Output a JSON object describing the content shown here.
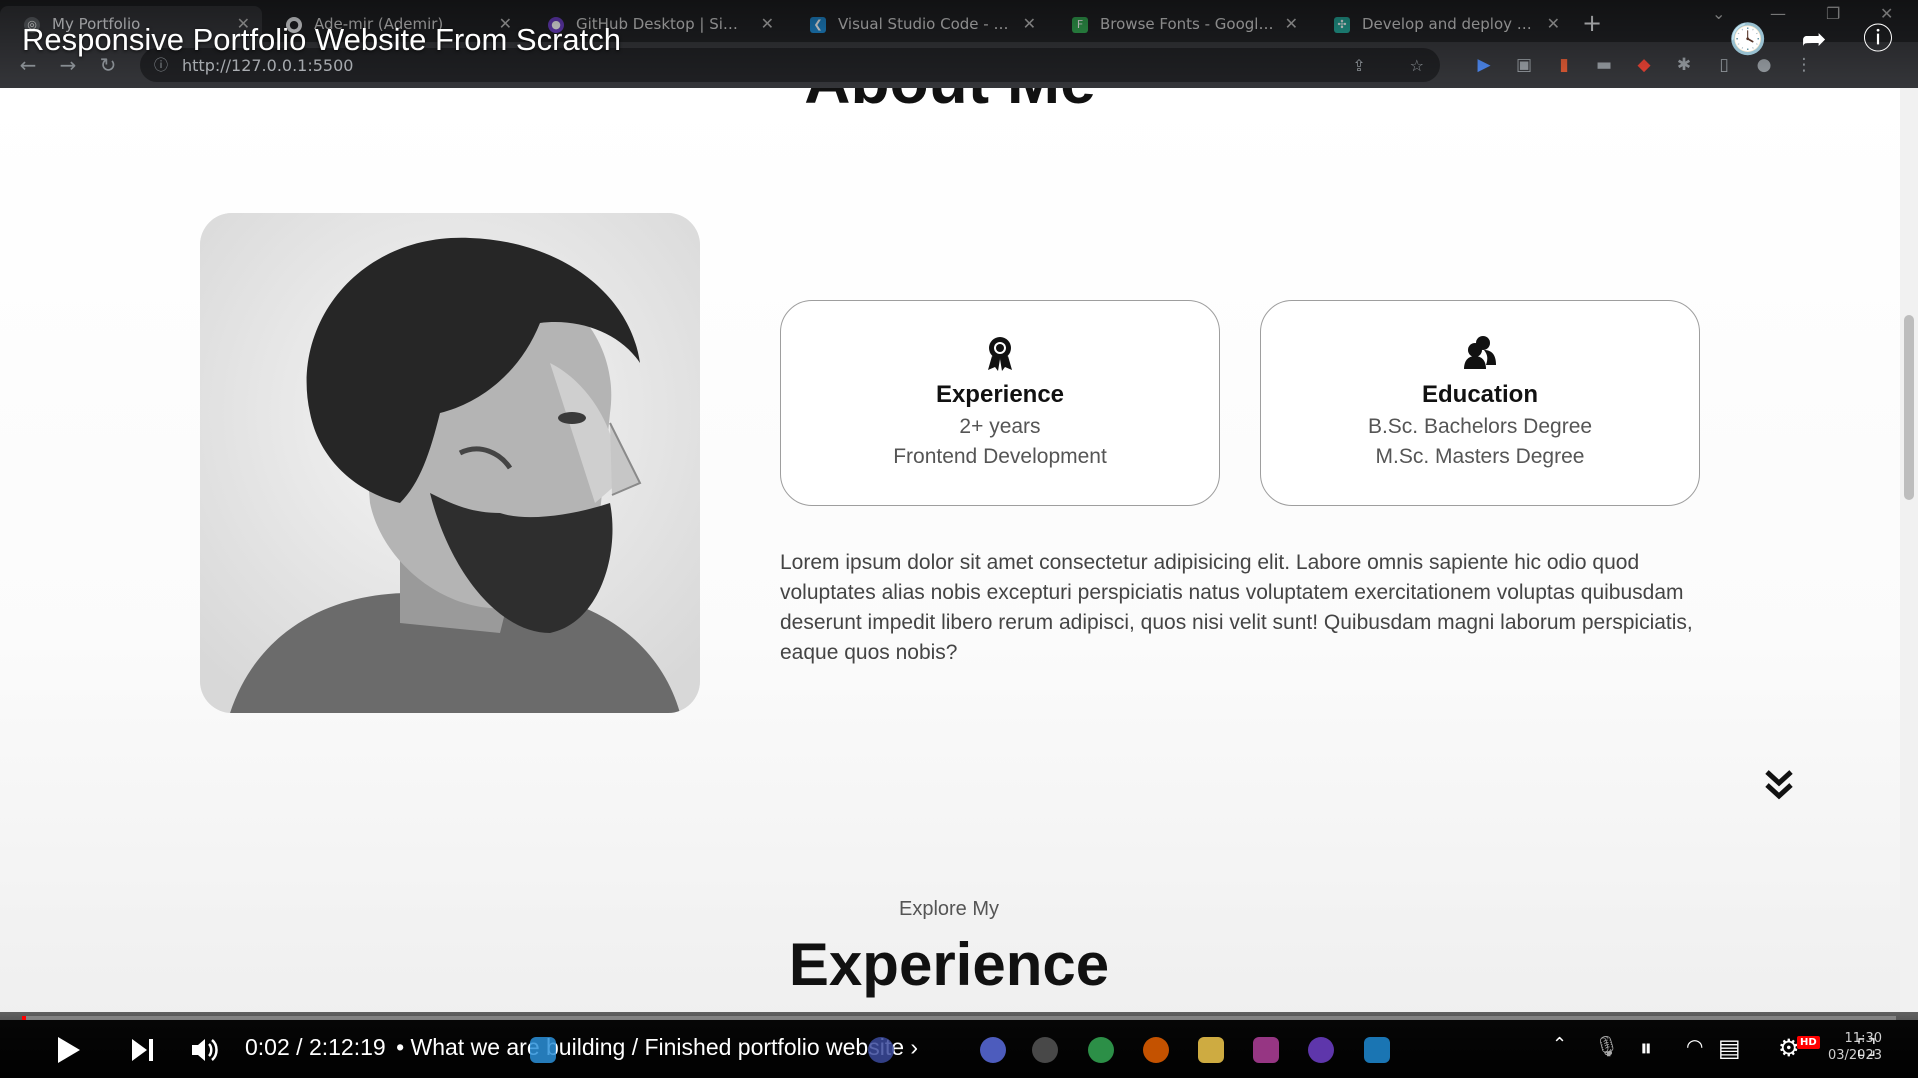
{
  "browser": {
    "tabs": [
      {
        "title": "My Portfolio",
        "icon": "globe-icon",
        "active": true
      },
      {
        "title": "Ade-mir (Ademir)",
        "icon": "github-icon",
        "active": false
      },
      {
        "title": "GitHub Desktop | Simple co",
        "icon": "github-desktop-icon",
        "active": false
      },
      {
        "title": "Visual Studio Code - Code",
        "icon": "vscode-icon",
        "active": false
      },
      {
        "title": "Browse Fonts - Google Fon",
        "icon": "google-fonts-icon",
        "active": false
      },
      {
        "title": "Develop and deploy websit",
        "icon": "netlify-icon",
        "active": false
      }
    ],
    "url": "http://127.0.0.1:5500"
  },
  "video": {
    "title": "Responsive Portfolio Website From Scratch",
    "current_time": "0:02",
    "duration": "2:12:19",
    "chapter": "• What we are building / Finished portfolio website",
    "chapter_chevron": "›",
    "progress_fraction": 0.0003,
    "quality_badge": "HD",
    "clock_time": "11:30",
    "clock_date": "03/2023"
  },
  "page": {
    "about_heading": "About Me",
    "cards": [
      {
        "icon": "award-icon",
        "title": "Experience",
        "lines": [
          "2+ years",
          "Frontend Development"
        ]
      },
      {
        "icon": "education-icon",
        "title": "Education",
        "lines": [
          "B.Sc. Bachelors Degree",
          "M.Sc. Masters Degree"
        ]
      }
    ],
    "about_text": "Lorem ipsum dolor sit amet consectetur adipisicing elit. Labore omnis sapiente hic odio quod voluptates alias nobis excepturi perspiciatis natus voluptatem exercitationem voluptas quibusdam deserunt impedit libero rerum adipisci, quos nisi velit sunt! Quibusdam magni laborum perspiciatis, eaque quos nobis?",
    "explore_subtitle": "Explore My",
    "explore_title": "Experience"
  },
  "colors": {
    "progress": "#ff0000",
    "chrome_dark": "#202124",
    "chrome_mid": "#35363a"
  }
}
